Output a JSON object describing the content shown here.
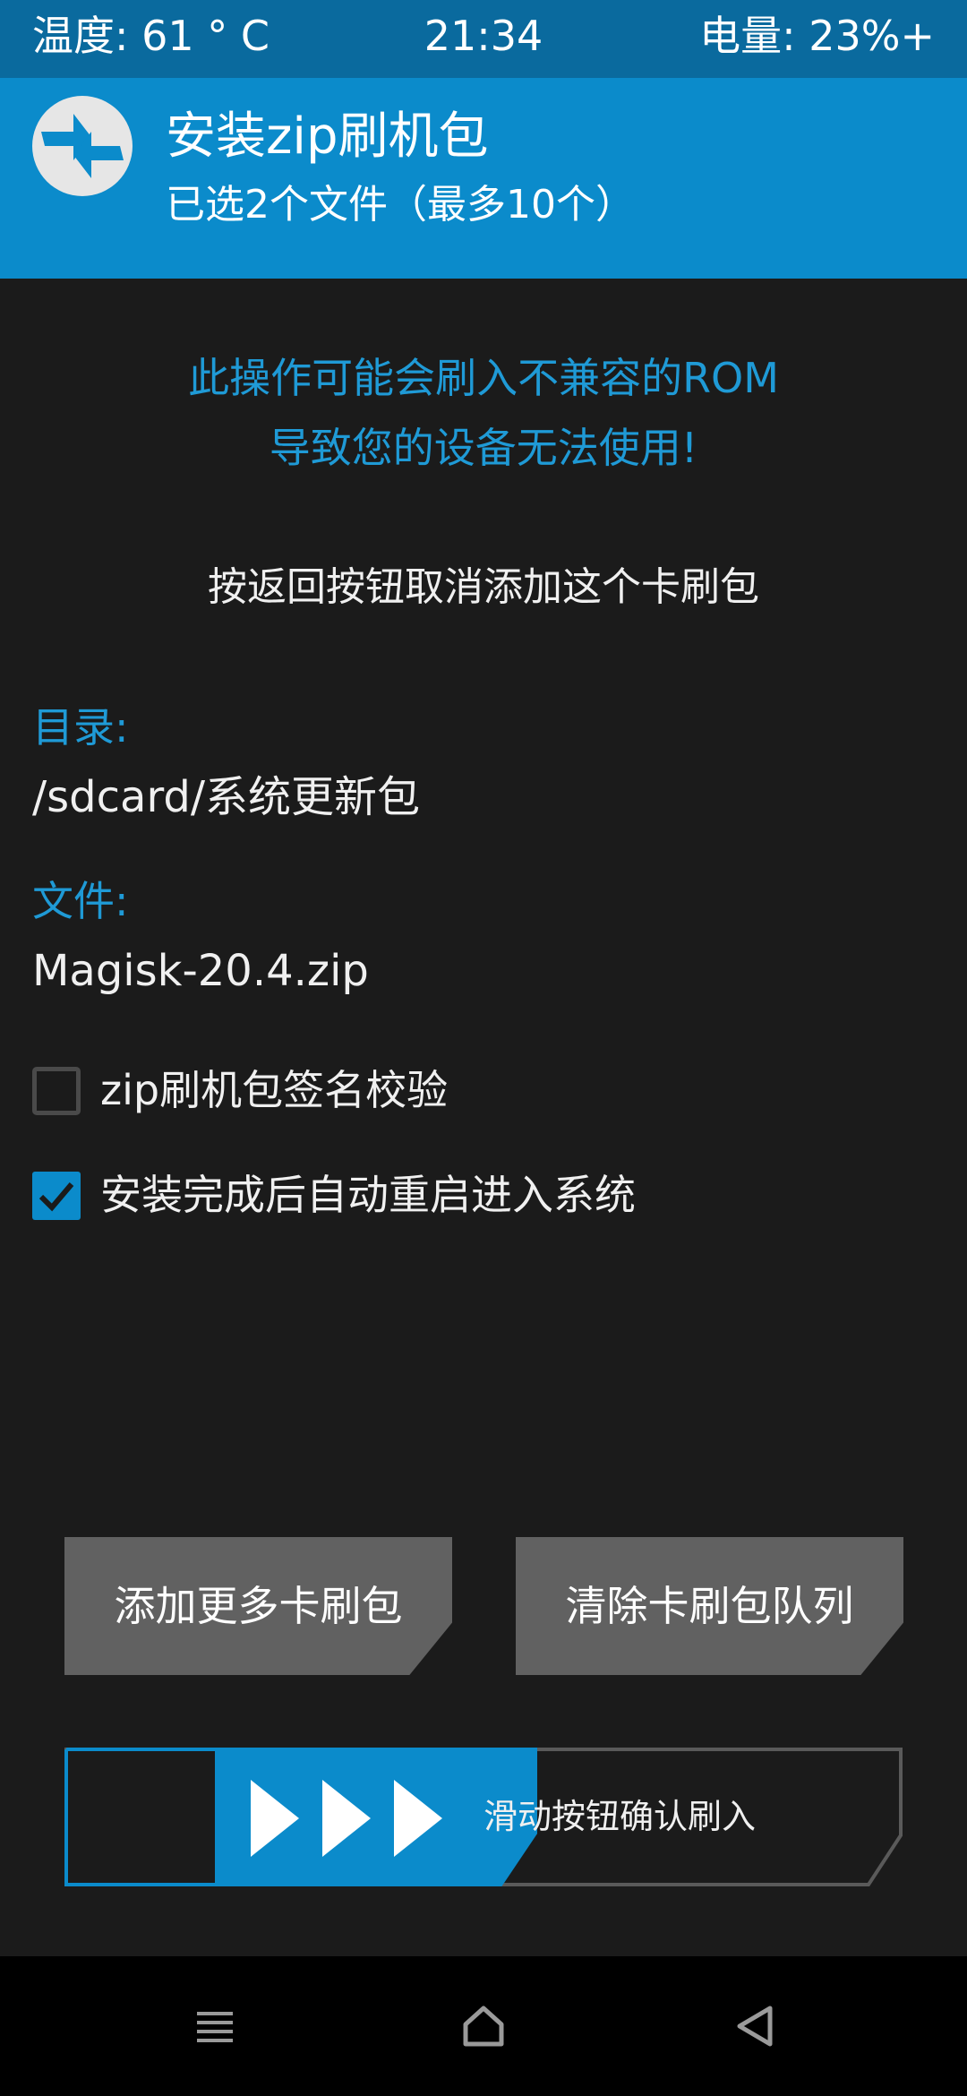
{
  "status_bar": {
    "temperature": "温度: 61 ° C",
    "time": "21:34",
    "battery": "电量: 23%+"
  },
  "header": {
    "logo_icon": "twrp-logo-icon",
    "title": "安装zip刷机包",
    "subtitle": "已选2个文件（最多10个）"
  },
  "warning": {
    "line1": "此操作可能会刷入不兼容的ROM",
    "line2": "导致您的设备无法使用!"
  },
  "notice": "按返回按钮取消添加这个卡刷包",
  "directory": {
    "label": "目录:",
    "value": "/sdcard/系统更新包"
  },
  "file": {
    "label": "文件:",
    "value": "Magisk-20.4.zip"
  },
  "options": [
    {
      "label": "zip刷机包签名校验",
      "checked": false
    },
    {
      "label": "安装完成后自动重启进入系统",
      "checked": true
    }
  ],
  "buttons": {
    "add_more": "添加更多卡刷包",
    "clear_queue": "清除卡刷包队列"
  },
  "slider": {
    "label": "滑动按钮确认刷入",
    "handle_icon": "triple-play-arrow-icon"
  },
  "nav_bar": {
    "menu_icon": "menu-icon",
    "home_icon": "home-icon",
    "back_icon": "back-triangle-icon"
  },
  "colors": {
    "accent": "#0b8bcb",
    "status_bar": "#0a6a9e",
    "background": "#1b1b1b",
    "button": "#616161",
    "warning_text": "#1f9ad6"
  }
}
